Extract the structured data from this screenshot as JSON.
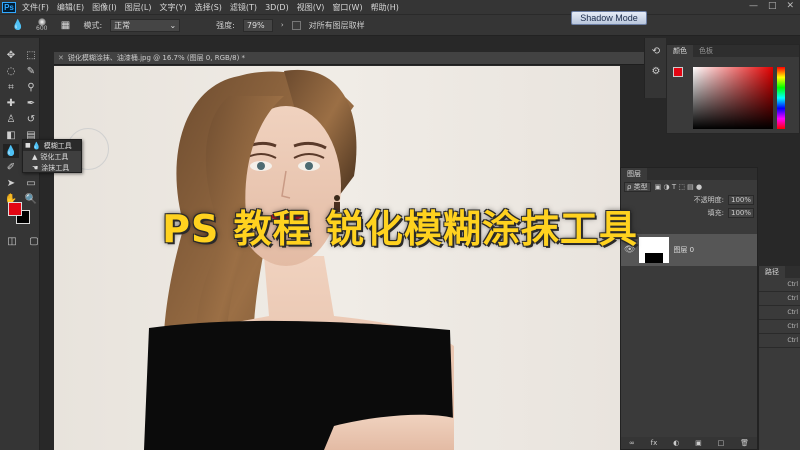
{
  "app": {
    "logo": "Ps"
  },
  "menu": [
    "文件(F)",
    "编辑(E)",
    "图像(I)",
    "图层(L)",
    "文字(Y)",
    "选择(S)",
    "滤镜(T)",
    "3D(D)",
    "视图(V)",
    "窗口(W)",
    "帮助(H)"
  ],
  "window_controls": [
    "—",
    "□",
    "✕"
  ],
  "options_bar": {
    "brush_size": "600",
    "mode_label": "模式:",
    "mode_value": "正常",
    "strength_label": "强度:",
    "strength_value": "79%",
    "sample_all_label": "对所有图层取样"
  },
  "shadow_mode": "Shadow Mode",
  "document": {
    "tab_title": "锐化模糊涂抹、油漆桶.jpg @ 16.7% (图层 0, RGB/8) *"
  },
  "flyout": {
    "items": [
      "模糊工具",
      "锐化工具",
      "涂抹工具"
    ]
  },
  "color_panel": {
    "tabs": [
      "颜色",
      "色板"
    ],
    "fg_color": "#e30613"
  },
  "layers_panel": {
    "title": "图层",
    "filter_label": "ρ 类型",
    "opacity_label": "不透明度:",
    "opacity_value": "100%",
    "fill_label": "填充:",
    "fill_value": "100%",
    "layer_name": "图层 0",
    "footer_icons": [
      "∞",
      "fx",
      "◐",
      "▣",
      "□",
      "🗑"
    ]
  },
  "history_panel": {
    "tabs": [
      "路径"
    ],
    "rows": [
      "Ctrl",
      "Ctrl",
      "Ctrl",
      "Ctrl",
      "Ctrl"
    ]
  },
  "overlay_title": "PS 教程 锐化模糊涂抹工具",
  "colors": {
    "title_yellow": "#ffd21f",
    "foreground": "#e30613",
    "background": "#000000"
  }
}
